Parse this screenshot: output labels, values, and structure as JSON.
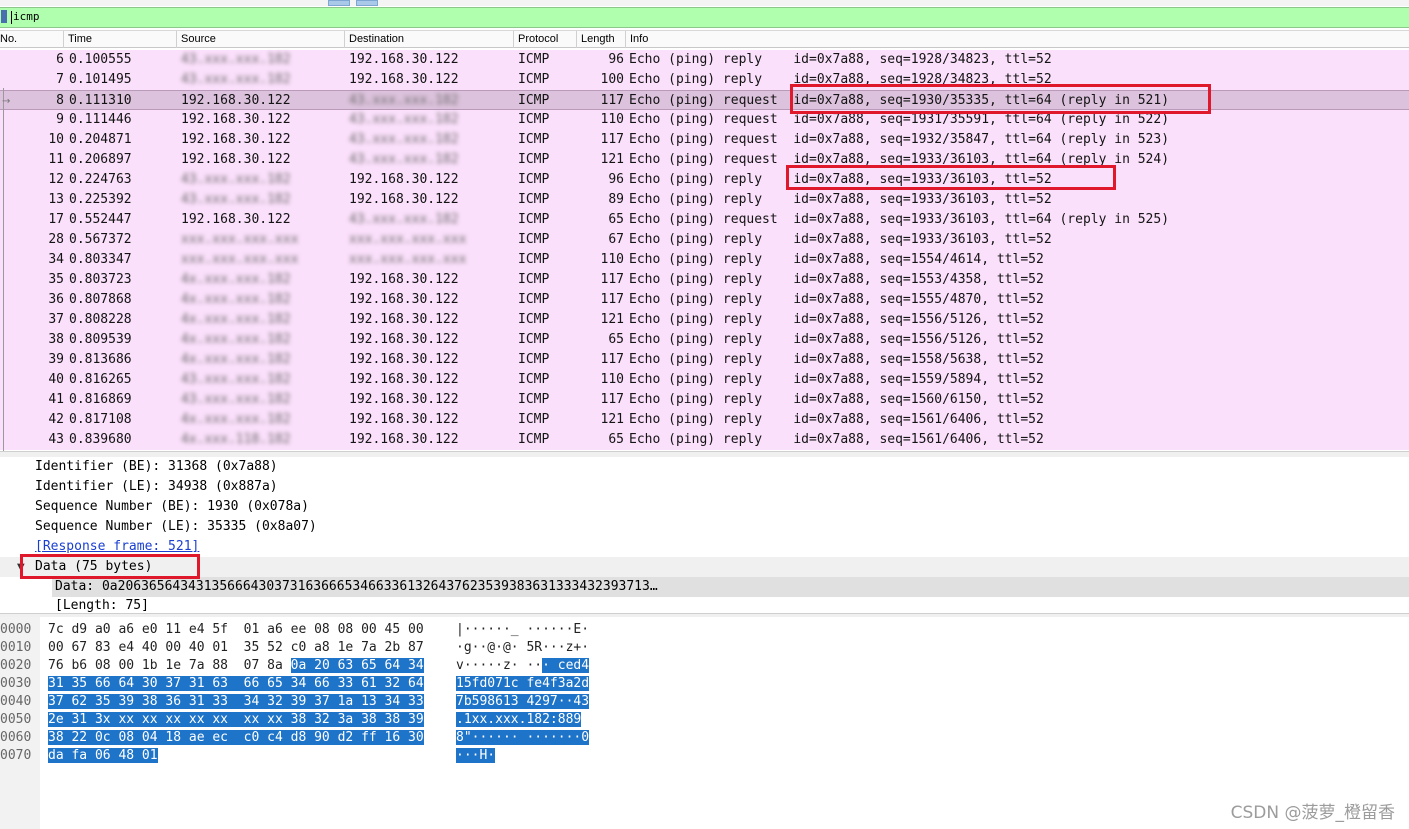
{
  "filter": {
    "value": "icmp"
  },
  "columns": [
    "No.",
    "Time",
    "Source",
    "Destination",
    "Protocol",
    "Length",
    "Info"
  ],
  "packets": [
    {
      "no": "6",
      "time": "0.100555",
      "src": "43.xxx.xxx.182",
      "dst": "192.168.30.122",
      "proto": "ICMP",
      "len": "96",
      "info": "Echo (ping) reply    id=0x7a88, seq=1928/34823, ttl=52",
      "src_blur": true,
      "dst_blur": false
    },
    {
      "no": "7",
      "time": "0.101495",
      "src": "43.xxx.xxx.182",
      "dst": "192.168.30.122",
      "proto": "ICMP",
      "len": "100",
      "info": "Echo (ping) reply    id=0x7a88, seq=1928/34823, ttl=52",
      "src_blur": true,
      "dst_blur": false
    },
    {
      "no": "8",
      "time": "0.111310",
      "src": "192.168.30.122",
      "dst": "43.xxx.xxx.182",
      "proto": "ICMP",
      "len": "117",
      "info": "Echo (ping) request  id=0x7a88, seq=1930/35335, ttl=64 (reply in 521)",
      "src_blur": false,
      "dst_blur": true,
      "selected": true
    },
    {
      "no": "9",
      "time": "0.111446",
      "src": "192.168.30.122",
      "dst": "43.xxx.xxx.182",
      "proto": "ICMP",
      "len": "110",
      "info": "Echo (ping) request  id=0x7a88, seq=1931/35591, ttl=64 (reply in 522)",
      "src_blur": false,
      "dst_blur": true
    },
    {
      "no": "10",
      "time": "0.204871",
      "src": "192.168.30.122",
      "dst": "43.xxx.xxx.182",
      "proto": "ICMP",
      "len": "117",
      "info": "Echo (ping) request  id=0x7a88, seq=1932/35847, ttl=64 (reply in 523)",
      "src_blur": false,
      "dst_blur": true
    },
    {
      "no": "11",
      "time": "0.206897",
      "src": "192.168.30.122",
      "dst": "43.xxx.xxx.182",
      "proto": "ICMP",
      "len": "121",
      "info": "Echo (ping) request  id=0x7a88, seq=1933/36103, ttl=64 (reply in 524)",
      "src_blur": false,
      "dst_blur": true
    },
    {
      "no": "12",
      "time": "0.224763",
      "src": "43.xxx.xxx.182",
      "dst": "192.168.30.122",
      "proto": "ICMP",
      "len": "96",
      "info": "Echo (ping) reply    id=0x7a88, seq=1933/36103, ttl=52",
      "src_blur": true,
      "dst_blur": false
    },
    {
      "no": "13",
      "time": "0.225392",
      "src": "43.xxx.xxx.182",
      "dst": "192.168.30.122",
      "proto": "ICMP",
      "len": "89",
      "info": "Echo (ping) reply    id=0x7a88, seq=1933/36103, ttl=52",
      "src_blur": true,
      "dst_blur": false
    },
    {
      "no": "17",
      "time": "0.552447",
      "src": "192.168.30.122",
      "dst": "43.xxx.xxx.182",
      "proto": "ICMP",
      "len": "65",
      "info": "Echo (ping) request  id=0x7a88, seq=1933/36103, ttl=64 (reply in 525)",
      "src_blur": false,
      "dst_blur": true
    },
    {
      "no": "28",
      "time": "0.567372",
      "src": "xxx.xxx.xxx.xxx",
      "dst": "xxx.xxx.xxx.xxx",
      "proto": "ICMP",
      "len": "67",
      "info": "Echo (ping) reply    id=0x7a88, seq=1933/36103, ttl=52",
      "src_blur": true,
      "dst_blur": true
    },
    {
      "no": "34",
      "time": "0.803347",
      "src": "xxx.xxx.xxx.xxx",
      "dst": "xxx.xxx.xxx.xxx",
      "proto": "ICMP",
      "len": "110",
      "info": "Echo (ping) reply    id=0x7a88, seq=1554/4614, ttl=52",
      "src_blur": true,
      "dst_blur": true
    },
    {
      "no": "35",
      "time": "0.803723",
      "src": "4x.xxx.xxx.182",
      "dst": "192.168.30.122",
      "proto": "ICMP",
      "len": "117",
      "info": "Echo (ping) reply    id=0x7a88, seq=1553/4358, ttl=52",
      "src_blur": true,
      "dst_blur": false
    },
    {
      "no": "36",
      "time": "0.807868",
      "src": "4x.xxx.xxx.182",
      "dst": "192.168.30.122",
      "proto": "ICMP",
      "len": "117",
      "info": "Echo (ping) reply    id=0x7a88, seq=1555/4870, ttl=52",
      "src_blur": true,
      "dst_blur": false
    },
    {
      "no": "37",
      "time": "0.808228",
      "src": "4x.xxx.xxx.182",
      "dst": "192.168.30.122",
      "proto": "ICMP",
      "len": "121",
      "info": "Echo (ping) reply    id=0x7a88, seq=1556/5126, ttl=52",
      "src_blur": true,
      "dst_blur": false
    },
    {
      "no": "38",
      "time": "0.809539",
      "src": "4x.xxx.xxx.182",
      "dst": "192.168.30.122",
      "proto": "ICMP",
      "len": "65",
      "info": "Echo (ping) reply    id=0x7a88, seq=1556/5126, ttl=52",
      "src_blur": true,
      "dst_blur": false
    },
    {
      "no": "39",
      "time": "0.813686",
      "src": "4x.xxx.xxx.182",
      "dst": "192.168.30.122",
      "proto": "ICMP",
      "len": "117",
      "info": "Echo (ping) reply    id=0x7a88, seq=1558/5638, ttl=52",
      "src_blur": true,
      "dst_blur": false
    },
    {
      "no": "40",
      "time": "0.816265",
      "src": "43.xxx.xxx.182",
      "dst": "192.168.30.122",
      "proto": "ICMP",
      "len": "110",
      "info": "Echo (ping) reply    id=0x7a88, seq=1559/5894, ttl=52",
      "src_blur": true,
      "dst_blur": false
    },
    {
      "no": "41",
      "time": "0.816869",
      "src": "43.xxx.xxx.182",
      "dst": "192.168.30.122",
      "proto": "ICMP",
      "len": "117",
      "info": "Echo (ping) reply    id=0x7a88, seq=1560/6150, ttl=52",
      "src_blur": true,
      "dst_blur": false
    },
    {
      "no": "42",
      "time": "0.817108",
      "src": "4x.xxx.xxx.182",
      "dst": "192.168.30.122",
      "proto": "ICMP",
      "len": "121",
      "info": "Echo (ping) reply    id=0x7a88, seq=1561/6406, ttl=52",
      "src_blur": true,
      "dst_blur": false
    },
    {
      "no": "43",
      "time": "0.839680",
      "src": "4x.xxx.118.182",
      "dst": "192.168.30.122",
      "proto": "ICMP",
      "len": "65",
      "info": "Echo (ping) reply    id=0x7a88, seq=1561/6406, ttl=52",
      "src_blur": true,
      "dst_blur": false
    }
  ],
  "details": {
    "identifier_be": "Identifier (BE): 31368 (0x7a88)",
    "identifier_le": "Identifier (LE): 34938 (0x887a)",
    "seq_be": "Sequence Number (BE): 1930 (0x078a)",
    "seq_le": "Sequence Number (LE): 35335 (0x8a07)",
    "response_frame": "[Response frame: 521]",
    "data_header": "Data (75 bytes)",
    "data_value": "Data: 0a20636564343135666430373163666534663361326437623539383631333432393713…",
    "length": "[Length: 75]"
  },
  "bytes": [
    {
      "off": "0000",
      "hex": "7c d9 a0 a6 e0 11 e4 5f  01 a6 ee 08 08 00 45 00",
      "hl": "",
      "ascii": "|······_ ······E·",
      "ahl": ""
    },
    {
      "off": "0010",
      "hex": "00 67 83 e4 40 00 40 01  35 52 c0 a8 1e 7a 2b 87",
      "hl": "",
      "ascii": "·g··@·@· 5R···z+·",
      "ahl": ""
    },
    {
      "off": "0020",
      "hex": "76 b6 08 00 1b 1e 7a 88  07 8a ",
      "hl": "0a 20 63 65 64 34",
      "ascii": "v·····z· ··",
      "ahl": "· ced4"
    },
    {
      "off": "0030",
      "hex": "",
      "hl": "31 35 66 64 30 37 31 63  66 65 34 66 33 61 32 64",
      "ascii": "",
      "ahl": "15fd071c fe4f3a2d"
    },
    {
      "off": "0040",
      "hex": "",
      "hl": "37 62 35 39 38 36 31 33  34 32 39 37 1a 13 34 33",
      "ascii": "",
      "ahl": "7b598613 4297··43"
    },
    {
      "off": "0050",
      "hex": "",
      "hl": "2e 31 3x xx xx xx xx xx  xx xx 38 32 3a 38 38 39",
      "ascii": "",
      "ahl": ".1xx.xxx.182:889"
    },
    {
      "off": "0060",
      "hex": "",
      "hl": "38 22 0c 08 04 18 ae ec  c0 c4 d8 90 d2 ff 16 30",
      "ascii": "",
      "ahl": "8\"······ ·······0"
    },
    {
      "off": "0070",
      "hex": "",
      "hl": "da fa 06 48 01",
      "ascii": "",
      "ahl": "···H·"
    }
  ],
  "watermark": "CSDN @菠萝_橙留香",
  "colors": {
    "row_bg": "#fbe0fb",
    "selected_bg": "#dcc2dc",
    "filter_bg": "#afffaf",
    "highlight": "#1e74c8",
    "annotation": "#e0182c"
  }
}
